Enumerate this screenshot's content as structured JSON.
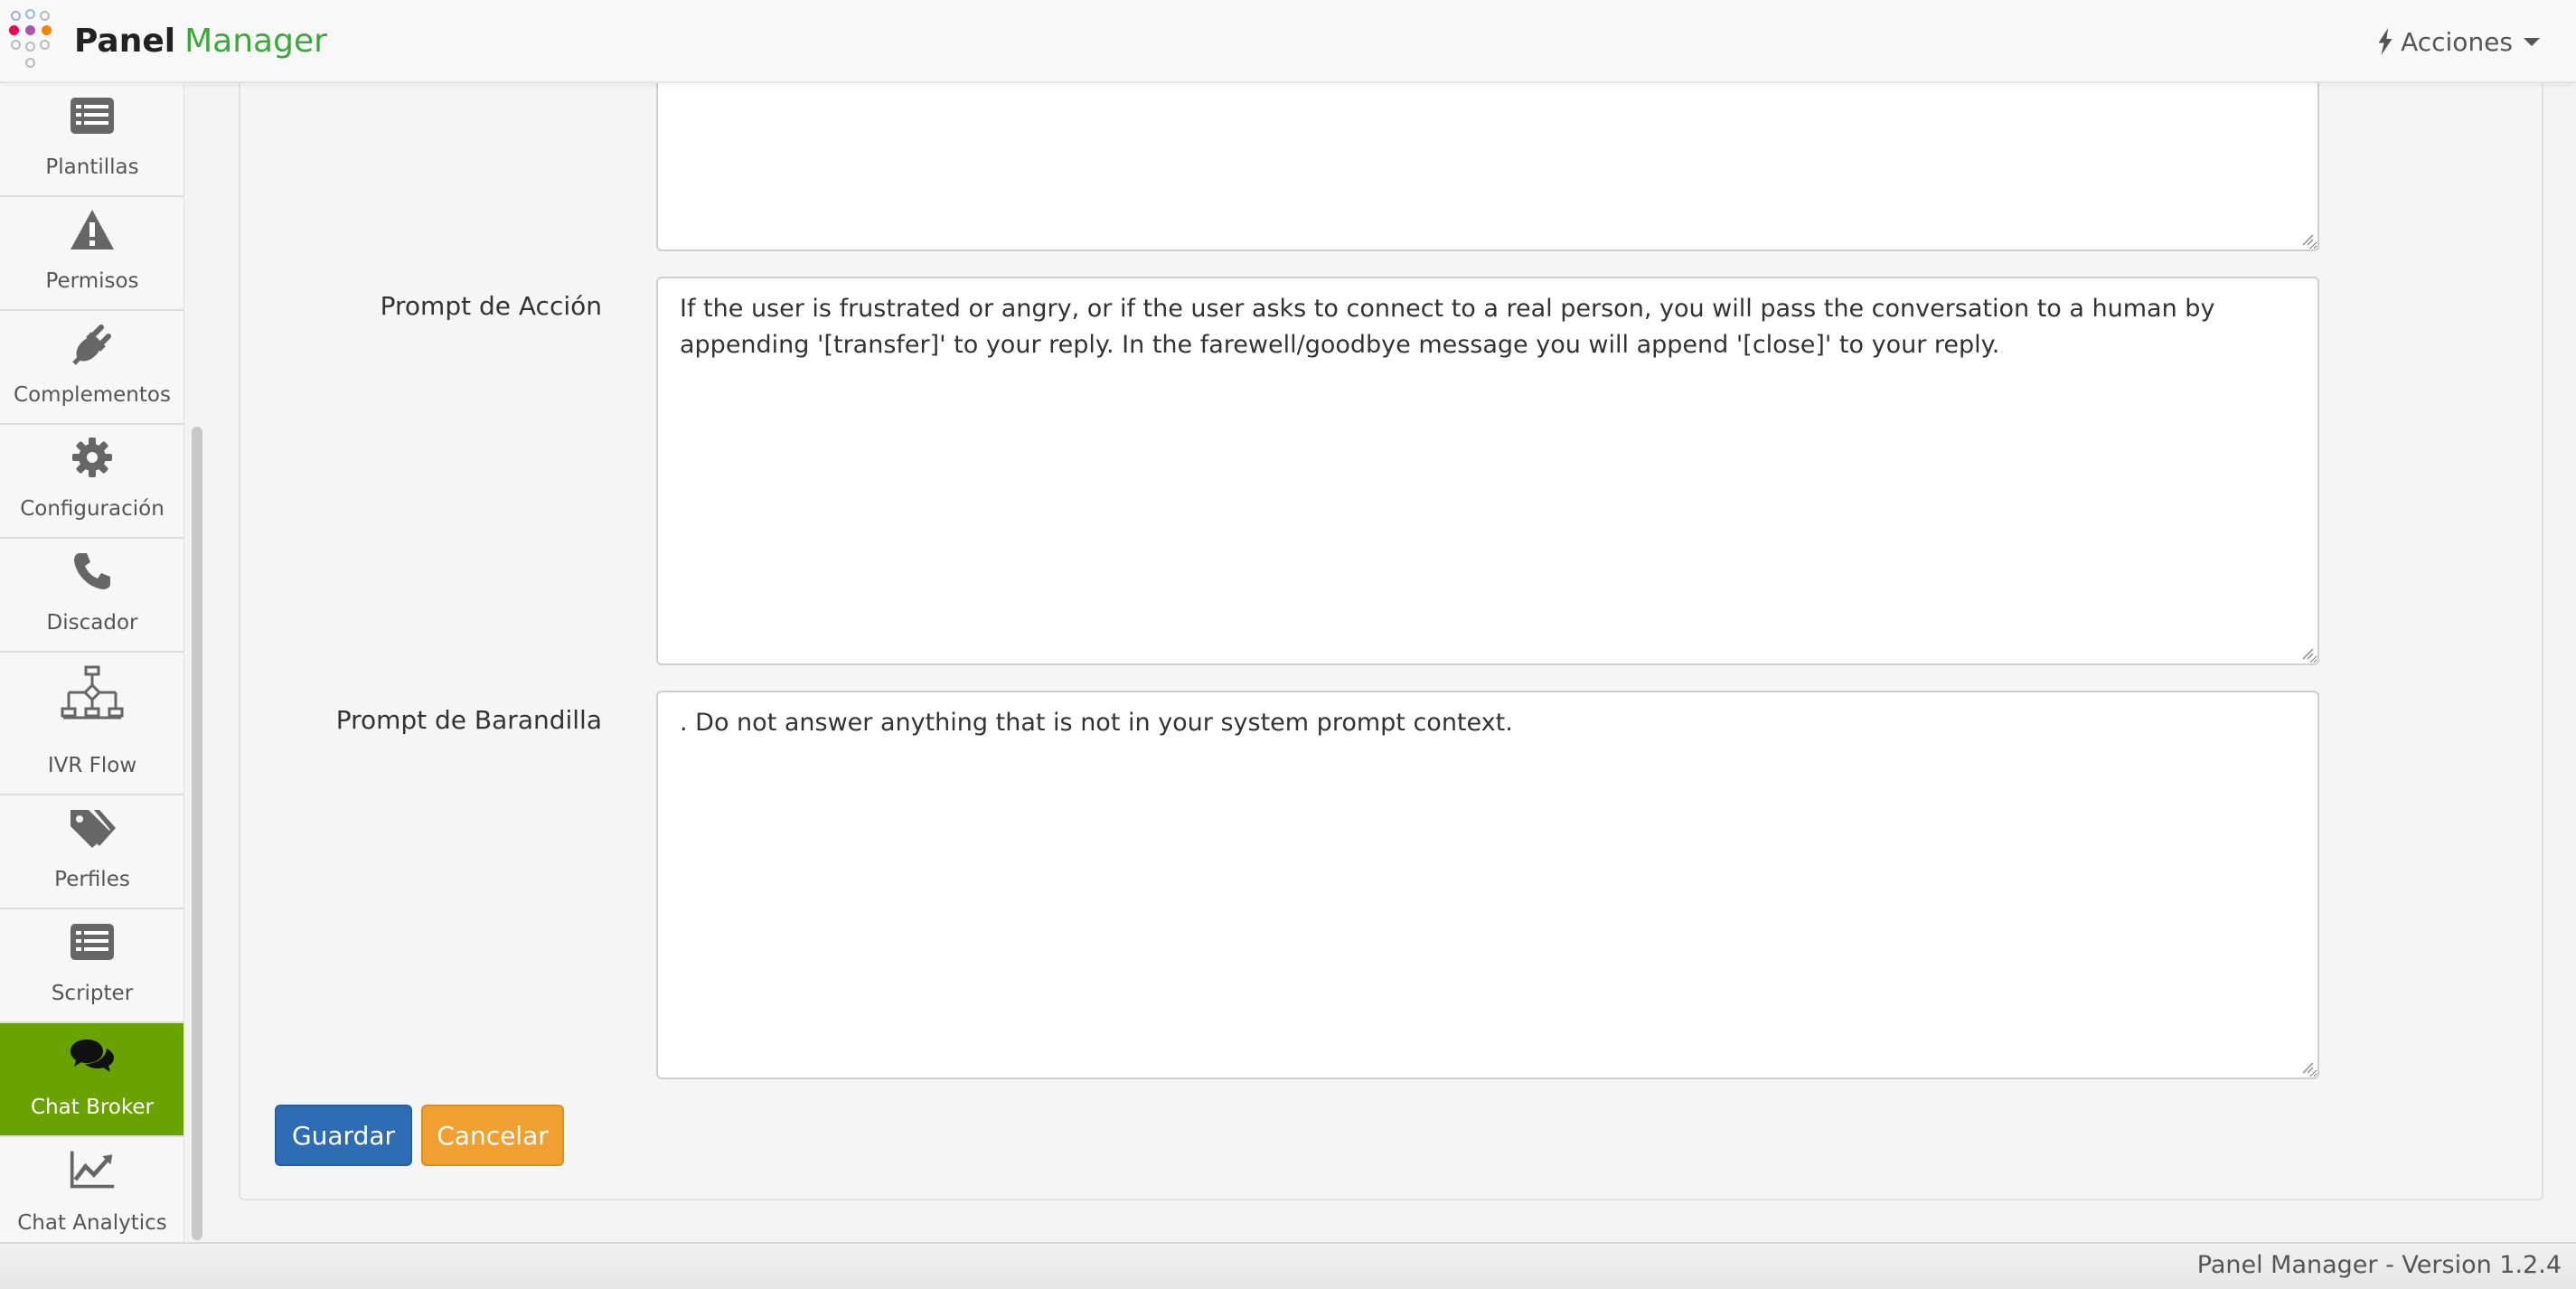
{
  "app": {
    "brand_bold": "Panel",
    "brand_light": "Manager",
    "actions_label": "Acciones"
  },
  "sidebar": {
    "items": [
      {
        "label": "Plantillas",
        "icon": "list-icon"
      },
      {
        "label": "Permisos",
        "icon": "warning-icon"
      },
      {
        "label": "Complementos",
        "icon": "plug-icon"
      },
      {
        "label": "Configuración",
        "icon": "gear-icon"
      },
      {
        "label": "Discador",
        "icon": "phone-icon"
      },
      {
        "label": "IVR Flow",
        "icon": "flow-icon"
      },
      {
        "label": "Perfiles",
        "icon": "tags-icon"
      },
      {
        "label": "Scripter",
        "icon": "list-icon"
      },
      {
        "label": "Chat Broker",
        "icon": "comments-icon",
        "active": true
      },
      {
        "label": "Chat Analytics",
        "icon": "line-chart-icon"
      }
    ],
    "active_color": "#6aa200"
  },
  "form": {
    "action_prompt_label": "Prompt de Acción",
    "action_prompt_value": "If the user is frustrated or angry, or if the user asks to connect to a real person, you will pass the conversation to a human by appending '[transfer]' to your reply. In the farewell/goodbye message you will append '[close]' to your reply.",
    "guardrail_prompt_label": "Prompt de Barandilla",
    "guardrail_prompt_value": ". Do not answer anything that is not in your system prompt context.",
    "save_label": "Guardar",
    "cancel_label": "Cancelar"
  },
  "footer": {
    "version_text": "Panel Manager - Version 1.2.4"
  }
}
